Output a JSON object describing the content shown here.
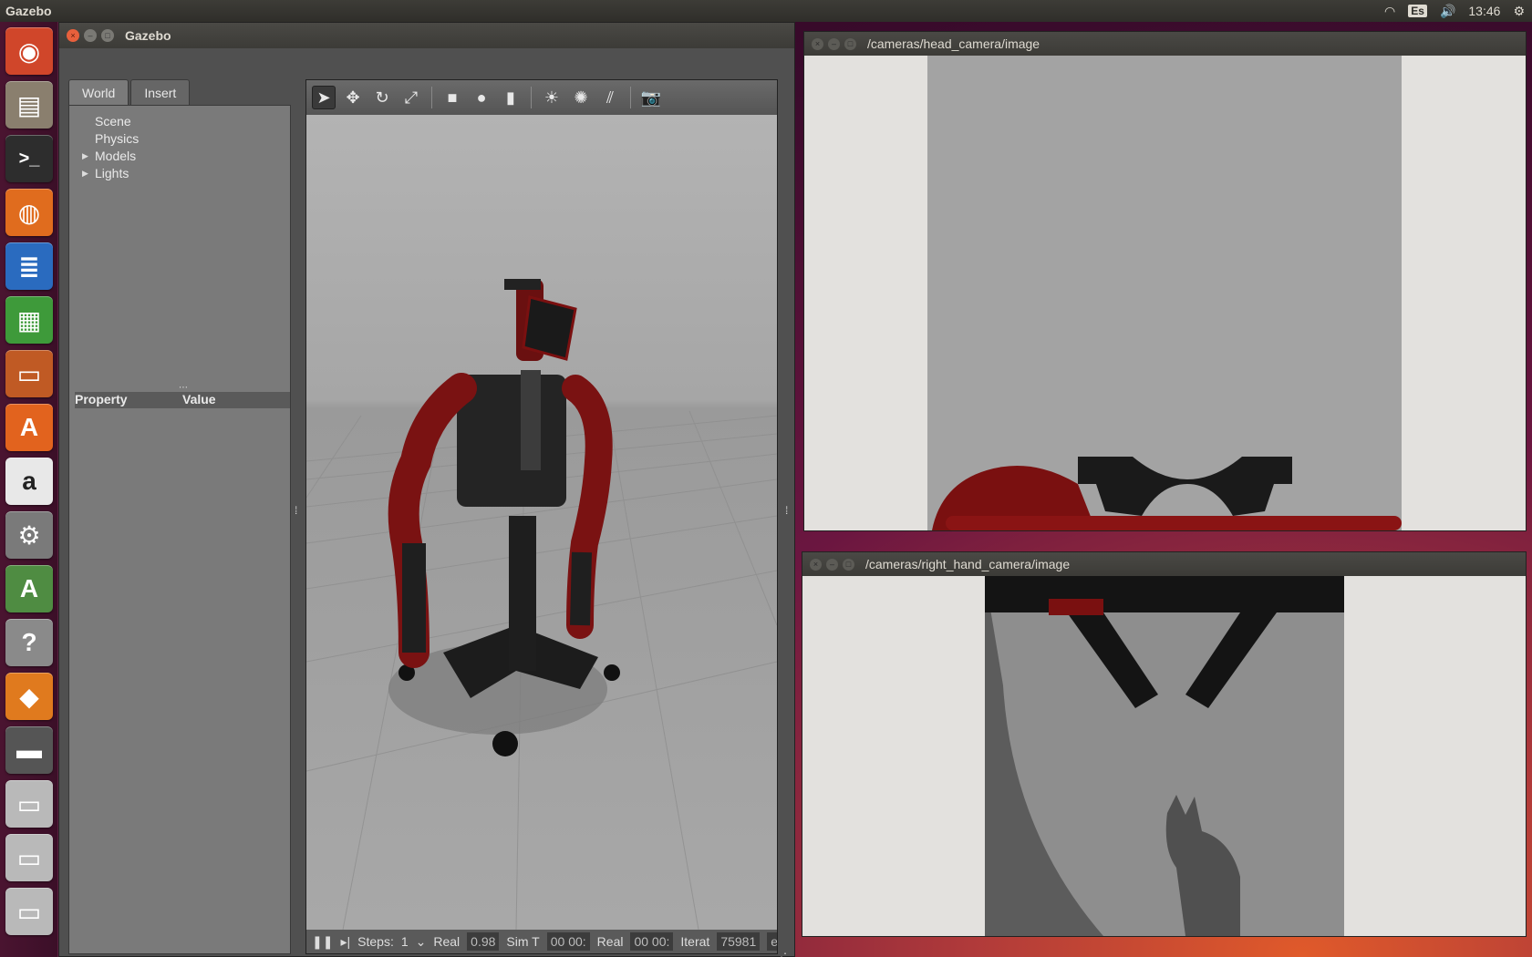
{
  "topbar": {
    "app_name": "Gazebo",
    "keyboard_layout": "Es",
    "clock": "13:46",
    "icons": [
      "wifi-icon",
      "keyboard-icon",
      "volume-icon",
      "settings-icon"
    ]
  },
  "launcher": {
    "items": [
      {
        "name": "ubuntu-dash",
        "glyph": "◉",
        "color": "#d0462a"
      },
      {
        "name": "files",
        "glyph": "▤",
        "color": "#8a7f6e"
      },
      {
        "name": "terminal",
        "glyph": ">_",
        "color": "#2d2d2d"
      },
      {
        "name": "firefox",
        "glyph": "◍",
        "color": "#e06c1e"
      },
      {
        "name": "writer",
        "glyph": "≣",
        "color": "#2a6bbf"
      },
      {
        "name": "calc",
        "glyph": "▦",
        "color": "#3e9a3a"
      },
      {
        "name": "impress",
        "glyph": "▭",
        "color": "#c05a24"
      },
      {
        "name": "software-center",
        "glyph": "A",
        "color": "#e2631e"
      },
      {
        "name": "amazon",
        "glyph": "a",
        "color": "#e8e8e8"
      },
      {
        "name": "system-settings",
        "glyph": "⚙",
        "color": "#7a7a7a"
      },
      {
        "name": "software-updater",
        "glyph": "A",
        "color": "#4f8c42"
      },
      {
        "name": "help",
        "glyph": "?",
        "color": "#8a8a8a"
      },
      {
        "name": "gazebo",
        "glyph": "◆",
        "color": "#e07a1e"
      },
      {
        "name": "workspace",
        "glyph": "▬",
        "color": "#555555"
      },
      {
        "name": "drive-1",
        "glyph": "▭",
        "color": "#b9b9b9"
      },
      {
        "name": "drive-2",
        "glyph": "▭",
        "color": "#b9b9b9"
      },
      {
        "name": "drive-3",
        "glyph": "▭",
        "color": "#b9b9b9"
      }
    ]
  },
  "gazebo": {
    "window_title": "Gazebo",
    "tabs": [
      {
        "label": "World",
        "active": true
      },
      {
        "label": "Insert",
        "active": false
      }
    ],
    "tree": [
      {
        "label": "Scene",
        "expandable": false
      },
      {
        "label": "Physics",
        "expandable": false
      },
      {
        "label": "Models",
        "expandable": true
      },
      {
        "label": "Lights",
        "expandable": true
      }
    ],
    "property_header": {
      "property": "Property",
      "value": "Value"
    },
    "toolbar": [
      "select-arrow-icon",
      "translate-icon",
      "rotate-icon",
      "scale-icon",
      "box-icon",
      "sphere-icon",
      "cylinder-icon",
      "point-light-icon",
      "spot-light-icon",
      "directional-light-icon",
      "screenshot-icon"
    ],
    "status": {
      "steps_label": "Steps:",
      "steps_value": "1",
      "real_label": "Real",
      "real_factor": "0.98",
      "sim_label": "Sim T",
      "sim_time": "00 00:",
      "real_time_label": "Real",
      "real_time": "00 00:",
      "iter_label": "Iterat",
      "iterations": "75981",
      "reset": "ese"
    }
  },
  "cameras": {
    "head": {
      "title": "/cameras/head_camera/image"
    },
    "hand": {
      "title": "/cameras/right_hand_camera/image"
    }
  }
}
